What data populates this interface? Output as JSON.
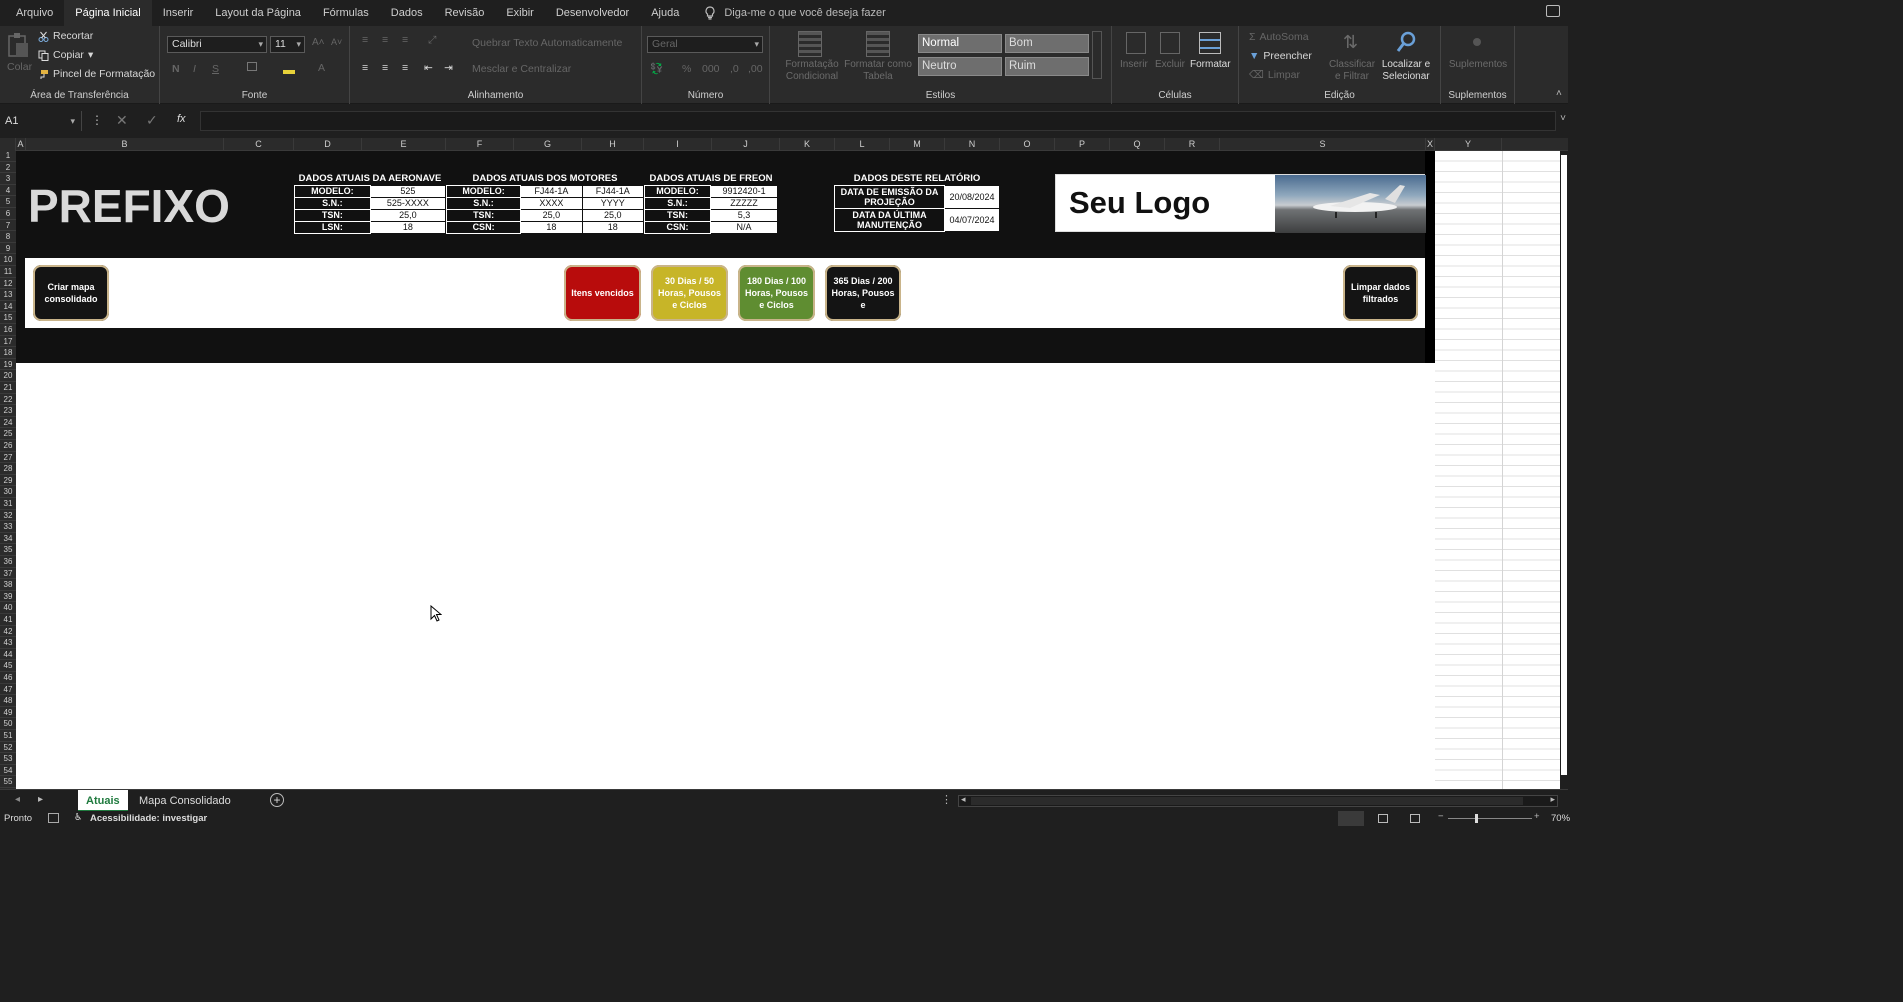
{
  "menu": {
    "items": [
      "Arquivo",
      "Página Inicial",
      "Inserir",
      "Layout da Página",
      "Fórmulas",
      "Dados",
      "Revisão",
      "Exibir",
      "Desenvolvedor",
      "Ajuda"
    ],
    "tell_me": "Diga-me o que você deseja fazer"
  },
  "ribbon": {
    "clipboard": {
      "paste": "Colar",
      "cut": "Recortar",
      "copy": "Copiar",
      "format_painter": "Pincel de Formatação",
      "label": "Área de Transferência"
    },
    "font": {
      "name": "Calibri",
      "size": "11",
      "label": "Fonte"
    },
    "alignment": {
      "wrap": "Quebrar Texto Automaticamente",
      "merge": "Mesclar e Centralizar",
      "label": "Alinhamento"
    },
    "number": {
      "format": "Geral",
      "label": "Número"
    },
    "styles": {
      "conditional": "Formatação Condicional",
      "as_table": "Formatar como Tabela",
      "normal": "Normal",
      "good": "Bom",
      "neutral": "Neutro",
      "bad": "Ruim",
      "label": "Estilos"
    },
    "cells": {
      "insert": "Inserir",
      "delete": "Excluir",
      "format": "Formatar",
      "label": "Células"
    },
    "editing": {
      "autosum": "AutoSoma",
      "fill": "Preencher",
      "clear": "Limpar",
      "sort": "Classificar e Filtrar",
      "find": "Localizar e Selecionar",
      "label": "Edição"
    },
    "addins": {
      "btn": "Suplementos",
      "label": "Suplementos"
    }
  },
  "formula_bar": {
    "name_box": "A1",
    "fx": "fx"
  },
  "columns": [
    "A",
    "B",
    "C",
    "D",
    "E",
    "F",
    "G",
    "H",
    "I",
    "J",
    "K",
    "L",
    "M",
    "N",
    "O",
    "P",
    "Q",
    "R",
    "S",
    "X",
    "Y"
  ],
  "rows_count": 55,
  "dashboard": {
    "prefix": "PREFIXO",
    "aircraft": {
      "title": "DADOS ATUAIS DA AERONAVE",
      "rows": [
        [
          "MODELO:",
          "525"
        ],
        [
          "S.N.:",
          "525-XXXX"
        ],
        [
          "TSN:",
          "25,0"
        ],
        [
          "LSN:",
          "18"
        ]
      ]
    },
    "engines": {
      "title": "DADOS ATUAIS DOS MOTORES",
      "rows": [
        [
          "MODELO:",
          "FJ44-1A",
          "FJ44-1A"
        ],
        [
          "S.N.:",
          "XXXX",
          "YYYY"
        ],
        [
          "TSN:",
          "25,0",
          "25,0"
        ],
        [
          "CSN:",
          "18",
          "18"
        ]
      ]
    },
    "freon": {
      "title": "DADOS ATUAIS DE FREON",
      "rows": [
        [
          "MODELO:",
          "9912420-1"
        ],
        [
          "S.N.:",
          "ZZZZZ"
        ],
        [
          "TSN:",
          "5,3"
        ],
        [
          "CSN:",
          "N/A"
        ]
      ]
    },
    "report": {
      "title": "DADOS DESTE RELATÓRIO",
      "rows": [
        [
          "DATA DE EMISSÃO DA PROJEÇÃO",
          "20/08/2024"
        ],
        [
          "DATA DA ÚLTIMA MANUTENÇÃO",
          "04/07/2024"
        ]
      ]
    },
    "logo_text": "Seu Logo",
    "buttons": {
      "create_map": "Criar mapa consolidado",
      "expired": "Itens vencidos",
      "d30": "30 Dias / 50 Horas, Pousos e Ciclos",
      "d180": "180 Dias / 100 Horas, Pousos e Ciclos",
      "d365": "365 Dias / 200 Horas, Pousos e",
      "clear": "Limpar dados filtrados"
    },
    "colors": {
      "red": "#b80c0c",
      "yellow": "#c7b528",
      "green": "#5f8d31",
      "black": "#141414"
    }
  },
  "sheets": {
    "tabs": [
      "Atuais",
      "Mapa Consolidado"
    ],
    "active": "Atuais"
  },
  "status": {
    "ready": "Pronto",
    "accessibility": "Acessibilidade: investigar",
    "zoom": "70%"
  }
}
